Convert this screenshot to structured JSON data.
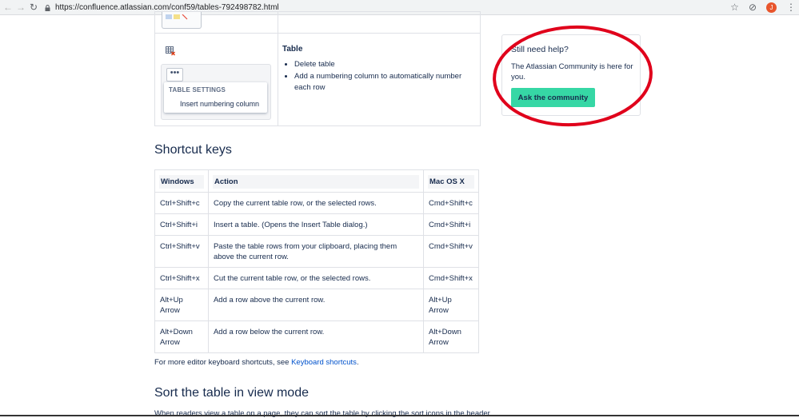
{
  "browser": {
    "url": "https://confluence.atlassian.com/conf59/tables-792498782.html",
    "avatar_letter": "J"
  },
  "feature": {
    "menu_more": "•••",
    "menu_heading": "TABLE SETTINGS",
    "menu_item": "Insert numbering column",
    "title": "Table",
    "bullets": [
      "Delete table",
      "Add a numbering column to automatically number each row"
    ]
  },
  "shortcut_heading": "Shortcut keys",
  "shortcut_table": {
    "headers": [
      "Windows",
      "Action",
      "Mac OS X"
    ],
    "rows": [
      [
        "Ctrl+Shift+c",
        "Copy the current table row, or the selected rows.",
        "Cmd+Shift+c"
      ],
      [
        "Ctrl+Shift+i",
        "Insert a table. (Opens the Insert Table dialog.)",
        "Cmd+Shift+i"
      ],
      [
        "Ctrl+Shift+v",
        "Paste the table rows from your clipboard, placing them above the current row.",
        "Cmd+Shift+v"
      ],
      [
        "Ctrl+Shift+x",
        "Cut the current table row, or the selected rows.",
        "Cmd+Shift+x"
      ],
      [
        "Alt+Up Arrow",
        "Add a row above the current row.",
        "Alt+Up Arrow"
      ],
      [
        "Alt+Down Arrow",
        "Add a row below the current row.",
        "Alt+Down Arrow"
      ]
    ]
  },
  "more_shortcuts": {
    "prefix": "For more editor keyboard shortcuts, see ",
    "link": "Keyboard shortcuts",
    "suffix": "."
  },
  "sort_heading": "Sort the table in view mode",
  "cutoff_text": "When readers view a table on a page, they can sort the table by clicking the sort icons in the header",
  "help": {
    "title": "Still need help?",
    "text": "The Atlassian Community is here for you.",
    "button": "Ask the community",
    "button_color": "#36d7a5"
  },
  "annotation_color": "#e0001b"
}
